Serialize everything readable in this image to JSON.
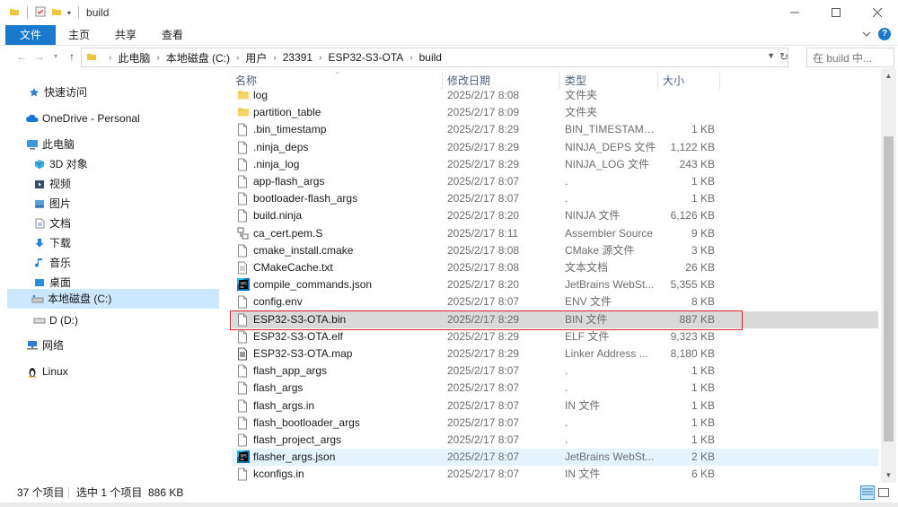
{
  "window": {
    "title": "build"
  },
  "ribbon": {
    "tabs": [
      "文件",
      "主页",
      "共享",
      "查看"
    ]
  },
  "address": {
    "crumbs": [
      "此电脑",
      "本地磁盘 (C:)",
      "用户",
      "23391",
      "ESP32-S3-OTA",
      "build"
    ],
    "search_placeholder": "在 build 中..."
  },
  "nav": {
    "items": [
      {
        "label": "快速访问",
        "icon": "star-icon"
      },
      {
        "label": "OneDrive - Personal",
        "icon": "cloud-icon"
      },
      {
        "label": "此电脑",
        "icon": "computer-icon"
      },
      {
        "label": "3D 对象",
        "icon": "cube-icon"
      },
      {
        "label": "视频",
        "icon": "video-icon"
      },
      {
        "label": "图片",
        "icon": "picture-icon"
      },
      {
        "label": "文档",
        "icon": "document-icon"
      },
      {
        "label": "下载",
        "icon": "download-icon"
      },
      {
        "label": "音乐",
        "icon": "music-icon"
      },
      {
        "label": "桌面",
        "icon": "desktop-icon"
      },
      {
        "label": "本地磁盘 (C:)",
        "icon": "drive-c-icon"
      },
      {
        "label": "D (D:)",
        "icon": "drive-d-icon"
      },
      {
        "label": "网络",
        "icon": "network-icon"
      },
      {
        "label": "Linux",
        "icon": "linux-icon"
      }
    ]
  },
  "list": {
    "columns": {
      "name": "名称",
      "date": "修改日期",
      "type": "类型",
      "size": "大小"
    },
    "rows": [
      {
        "name": "log",
        "date": "2025/2/17 8:08",
        "type": "文件夹",
        "size": "",
        "icon": "folder"
      },
      {
        "name": "partition_table",
        "date": "2025/2/17 8:09",
        "type": "文件夹",
        "size": "",
        "icon": "folder"
      },
      {
        "name": ".bin_timestamp",
        "date": "2025/2/17 8:29",
        "type": "BIN_TIMESTAMP...",
        "size": "1 KB",
        "icon": "file"
      },
      {
        "name": ".ninja_deps",
        "date": "2025/2/17 8:29",
        "type": "NINJA_DEPS 文件",
        "size": "1,122 KB",
        "icon": "file"
      },
      {
        "name": ".ninja_log",
        "date": "2025/2/17 8:29",
        "type": "NINJA_LOG 文件",
        "size": "243 KB",
        "icon": "file"
      },
      {
        "name": "app-flash_args",
        "date": "2025/2/17 8:07",
        "type": ".",
        "size": "1 KB",
        "icon": "file"
      },
      {
        "name": "bootloader-flash_args",
        "date": "2025/2/17 8:07",
        "type": ".",
        "size": "1 KB",
        "icon": "file"
      },
      {
        "name": "build.ninja",
        "date": "2025/2/17 8:20",
        "type": "NINJA 文件",
        "size": "6,126 KB",
        "icon": "file"
      },
      {
        "name": "ca_cert.pem.S",
        "date": "2025/2/17 8:11",
        "type": "Assembler Source",
        "size": "9 KB",
        "icon": "asm"
      },
      {
        "name": "cmake_install.cmake",
        "date": "2025/2/17 8:08",
        "type": "CMake 源文件",
        "size": "3 KB",
        "icon": "file"
      },
      {
        "name": "CMakeCache.txt",
        "date": "2025/2/17 8:08",
        "type": "文本文档",
        "size": "26 KB",
        "icon": "text"
      },
      {
        "name": "compile_commands.json",
        "date": "2025/2/17 8:20",
        "type": "JetBrains WebSt...",
        "size": "5,355 KB",
        "icon": "jetbrains"
      },
      {
        "name": "config.env",
        "date": "2025/2/17 8:07",
        "type": "ENV 文件",
        "size": "8 KB",
        "icon": "file"
      },
      {
        "name": "ESP32-S3-OTA.bin",
        "date": "2025/2/17 8:29",
        "type": "BIN 文件",
        "size": "887 KB",
        "icon": "file"
      },
      {
        "name": "ESP32-S3-OTA.elf",
        "date": "2025/2/17 8:29",
        "type": "ELF 文件",
        "size": "9,323 KB",
        "icon": "file"
      },
      {
        "name": "ESP32-S3-OTA.map",
        "date": "2025/2/17 8:29",
        "type": "Linker Address ...",
        "size": "8,180 KB",
        "icon": "map"
      },
      {
        "name": "flash_app_args",
        "date": "2025/2/17 8:07",
        "type": ".",
        "size": "1 KB",
        "icon": "file"
      },
      {
        "name": "flash_args",
        "date": "2025/2/17 8:07",
        "type": ".",
        "size": "1 KB",
        "icon": "file"
      },
      {
        "name": "flash_args.in",
        "date": "2025/2/17 8:07",
        "type": "IN 文件",
        "size": "1 KB",
        "icon": "file"
      },
      {
        "name": "flash_bootloader_args",
        "date": "2025/2/17 8:07",
        "type": ".",
        "size": "1 KB",
        "icon": "file"
      },
      {
        "name": "flash_project_args",
        "date": "2025/2/17 8:07",
        "type": ".",
        "size": "1 KB",
        "icon": "file"
      },
      {
        "name": "flasher_args.json",
        "date": "2025/2/17 8:07",
        "type": "JetBrains WebSt...",
        "size": "2 KB",
        "icon": "jetbrains"
      },
      {
        "name": "kconfigs.in",
        "date": "2025/2/17 8:07",
        "type": "IN 文件",
        "size": "6 KB",
        "icon": "file"
      }
    ]
  },
  "status": {
    "count": "37 个项目",
    "selection": "选中 1 个项目  886 KB"
  },
  "colors": {
    "accent": "#1979ca",
    "selection": "#d9d9d9",
    "highlight_box": "#e02020"
  }
}
